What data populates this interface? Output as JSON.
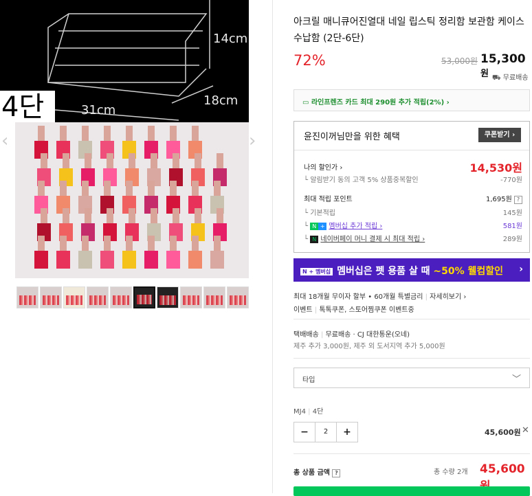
{
  "gallery": {
    "dims": {
      "height": "14cm",
      "width": "31cm",
      "depth": "18cm"
    },
    "tier_label": "4단",
    "prev_arrow": "‹",
    "next_arrow": "›",
    "thumb_count": 10,
    "selected_thumb": 6
  },
  "product": {
    "title": "아크릴 매니큐어진열대 네일 립스틱 정리함 보관함 케이스 수납함 (2단-6단)",
    "discount_rate": "72%",
    "original_price": "53,000원",
    "price": "15,300",
    "price_unit": "원",
    "shipping_short": "무료배송"
  },
  "card_promo": "라인프렌즈 카드 최대 290원 추가 적립(2%) ›",
  "benefit": {
    "header": "윤진이꺼님만을 위한 혜택",
    "coupon_button": "쿠폰받기 ›",
    "my_discount_label": "나의 할인가 ›",
    "my_discount_value": "14,530원",
    "my_discount_note": "알림받기 동의 고객 5% 상품중복할인",
    "my_discount_note_value": "-770원",
    "points_label": "최대 적립 포인트",
    "points_value": "1,695원",
    "help_mark": "?",
    "basic_label": "기본적립",
    "basic_value": "145원",
    "membership_label": "멤버십 추가 적립 ›",
    "membership_value": "581원",
    "npay_label": "네이버페이 머니 결제 시 최대 적립 ›",
    "npay_value": "289원",
    "npay_icon": "N",
    "n_icon": "N",
    "plus_icon": "+"
  },
  "banner": {
    "badge": "N + 멤버십",
    "text_before": "멤버십은 펫 용품 살 때 ",
    "highlight": "~50% 웰컴할인",
    "arrow": "›"
  },
  "installment": {
    "text": "최대 18개월 무이자 할부 • 60개월 특별금리",
    "link": "자세히보기 ›"
  },
  "events": {
    "label": "이벤트",
    "text": "톡톡쿠폰, 스토어찜쿠폰 이벤트중"
  },
  "delivery": {
    "type": "택배배송",
    "fee": "무료배송",
    "carrier": "CJ 대한통운(오네)",
    "extra": "제주 추가 3,000원, 제주 외 도서지역 추가 5,000원"
  },
  "option": {
    "placeholder": "타입",
    "selected_name": "MJ4",
    "selected_value": "4단"
  },
  "quantity": {
    "minus": "−",
    "value": "2",
    "plus": "+",
    "line_total": "45,600원",
    "remove": "✕"
  },
  "total": {
    "label": "총 상품 금액",
    "help": "?",
    "count": "총 수량 2개",
    "amount": "45,600원"
  }
}
